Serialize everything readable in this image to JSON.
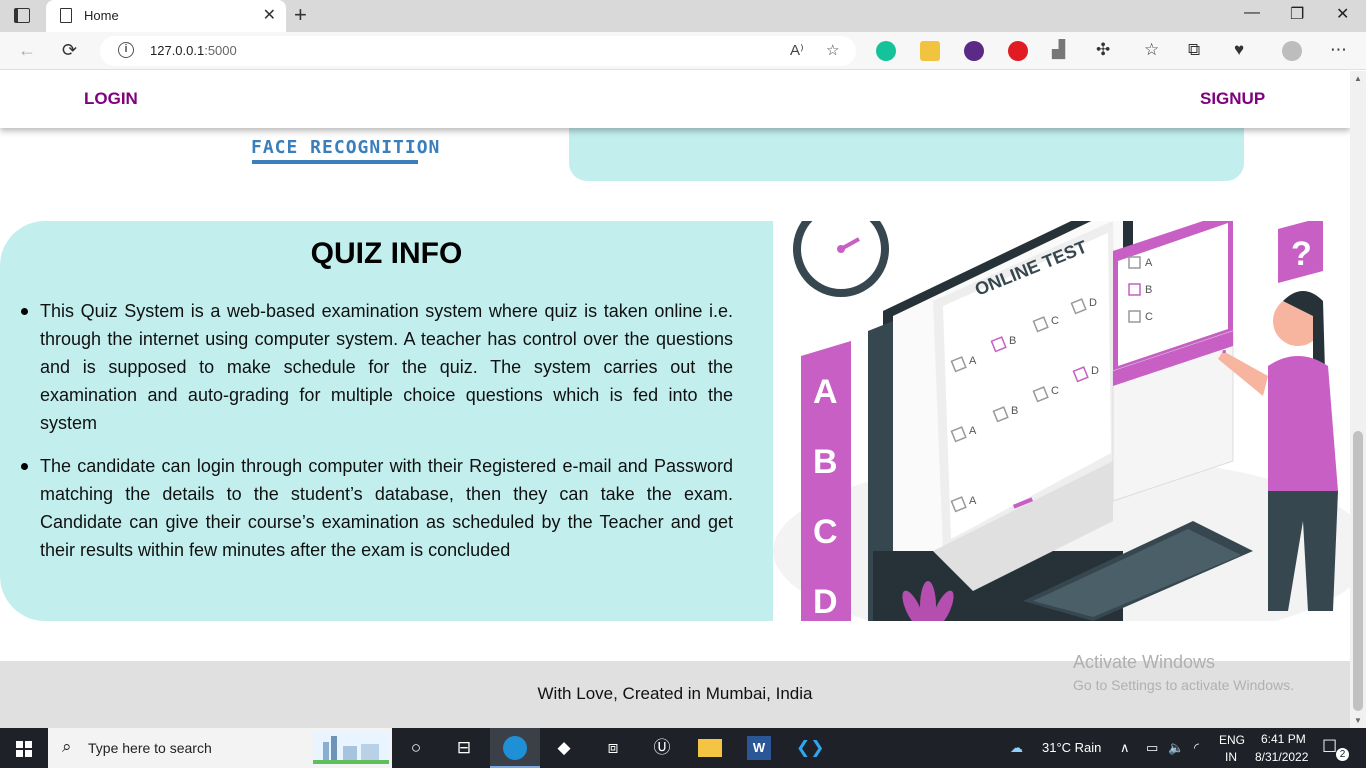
{
  "browser": {
    "tab_title": "Home",
    "tab_close": "✕",
    "new_tab": "+",
    "minimize": "—",
    "restore": "❐",
    "close": "✕",
    "url_host": "127.0.0.1",
    "url_port": ":5000",
    "icons": [
      "back-icon",
      "refresh-icon",
      "info-icon",
      "read-aloud-icon",
      "favorite-add-icon",
      "grammarly-icon",
      "extension-icon",
      "download-icon",
      "adblock-icon",
      "stats-icon",
      "puzzle-icon",
      "favorites-icon",
      "collections-icon",
      "health-icon",
      "profile-icon",
      "more-icon"
    ]
  },
  "nav": {
    "login": "LOGIN",
    "signup": "SIGNUP",
    "link_color": "#800080"
  },
  "page": {
    "face_logo": "FACE  RECOGNITION",
    "quiz_title": "QUIZ INFO",
    "quiz_points": [
      "This Quiz System is a web-based examination system where quiz is taken online i.e. through the internet using computer system. A teacher has control over the questions and is supposed to make schedule for the quiz. The system carries out the examination and auto-grading for multiple choice questions which is fed into the system",
      "The candidate can login through computer with their Registered e-mail and Password matching the details to the student’s database, then they can take the exam. Candidate can give their course’s examination as scheduled by the Teacher and get their results within few minutes after the exam is concluded"
    ],
    "card_color": "#c2eeee",
    "illustration": {
      "heading": "ONLINE TEST",
      "blocks": [
        "A",
        "B",
        "C",
        "D"
      ],
      "options": [
        "A",
        "B",
        "C",
        "D"
      ],
      "panel_options": [
        "A",
        "B",
        "C"
      ]
    },
    "footer": "With Love, Created in Mumbai, India"
  },
  "watermark": {
    "line1": "Activate Windows",
    "line2": "Go to Settings to activate Windows."
  },
  "taskbar": {
    "search_placeholder": "Type here to search",
    "weather": "31°C  Rain",
    "lang_top": "ENG",
    "lang_bottom": "IN",
    "time": "6:41 PM",
    "date": "8/31/2022",
    "notifications": "2",
    "apps": [
      "cortana-icon",
      "task-view-icon",
      "edge-icon",
      "inkscape-icon",
      "visual-studio-icon",
      "unreal-icon",
      "file-explorer-icon",
      "word-icon",
      "vscode-icon"
    ]
  }
}
